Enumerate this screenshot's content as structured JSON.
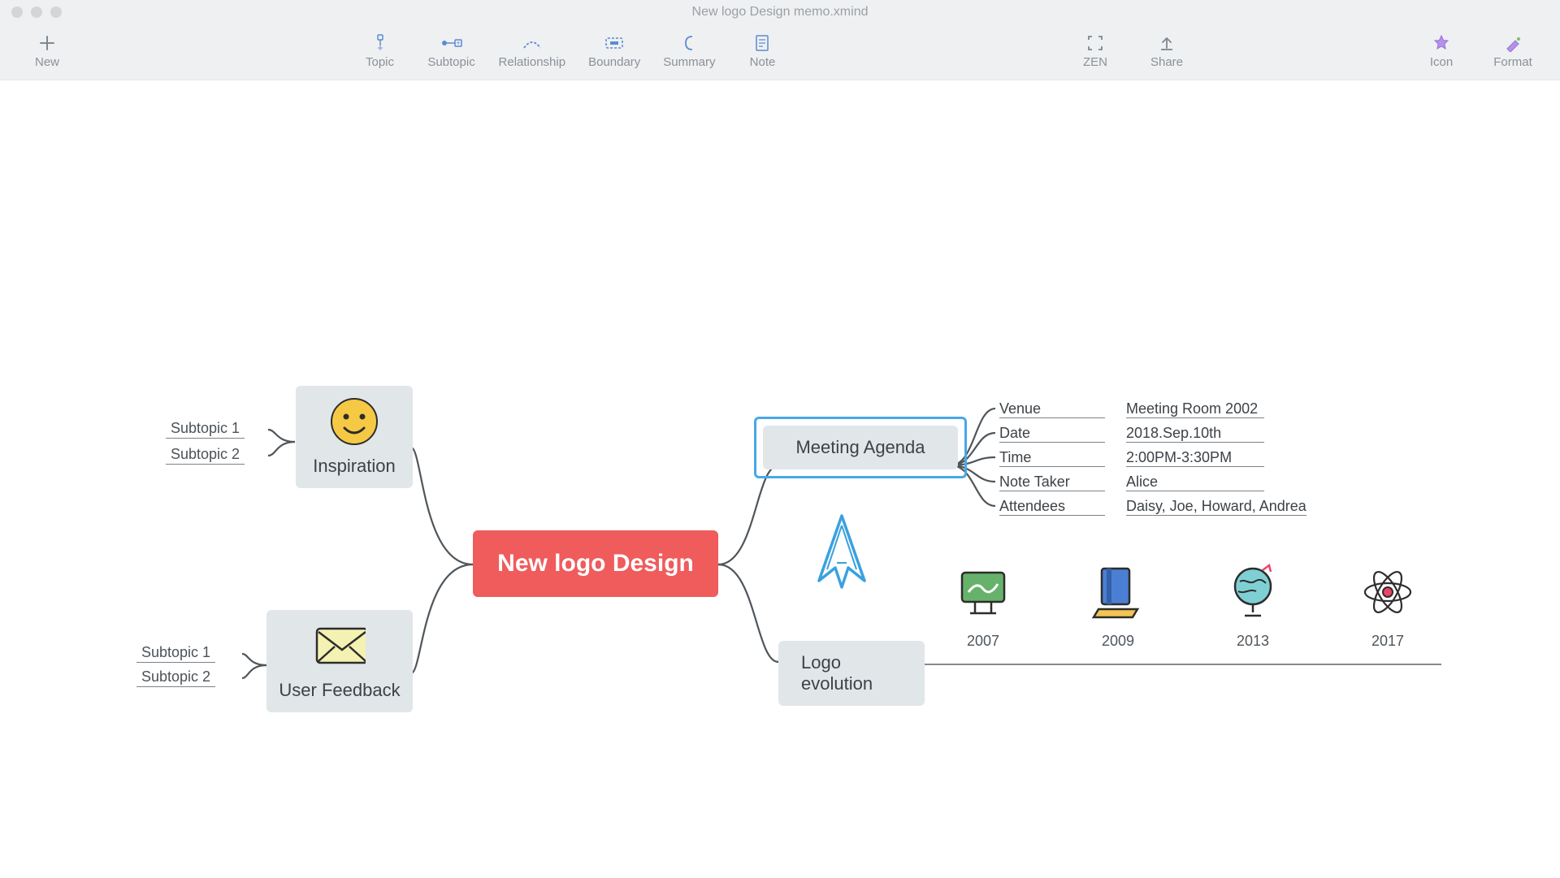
{
  "window": {
    "title": "New logo Design memo.xmind"
  },
  "toolbar": {
    "left": [
      {
        "id": "new",
        "label": "New"
      }
    ],
    "center": [
      {
        "id": "topic",
        "label": "Topic"
      },
      {
        "id": "subtopic",
        "label": "Subtopic"
      },
      {
        "id": "relationship",
        "label": "Relationship"
      },
      {
        "id": "boundary",
        "label": "Boundary"
      },
      {
        "id": "summary",
        "label": "Summary"
      },
      {
        "id": "note",
        "label": "Note"
      }
    ],
    "right1": [
      {
        "id": "zen",
        "label": "ZEN"
      },
      {
        "id": "share",
        "label": "Share"
      }
    ],
    "right2": [
      {
        "id": "icon",
        "label": "Icon"
      },
      {
        "id": "format",
        "label": "Format"
      }
    ]
  },
  "map": {
    "central": "New logo Design",
    "inspiration": {
      "label": "Inspiration",
      "subs": [
        "Subtopic 1",
        "Subtopic 2"
      ]
    },
    "feedback": {
      "label": "User Feedback",
      "subs": [
        "Subtopic 1",
        "Subtopic 2"
      ]
    },
    "meeting": {
      "label": "Meeting Agenda",
      "details": [
        {
          "k": "Venue",
          "v": "Meeting Room 2002"
        },
        {
          "k": "Date",
          "v": "2018.Sep.10th"
        },
        {
          "k": "Time",
          "v": "2:00PM-3:30PM"
        },
        {
          "k": "Note Taker",
          "v": "Alice"
        },
        {
          "k": "Attendees",
          "v": "Daisy, Joe, Howard, Andrea"
        }
      ]
    },
    "evolution": {
      "label": "Logo evolution",
      "years": [
        "2007",
        "2009",
        "2013",
        "2017"
      ]
    }
  }
}
